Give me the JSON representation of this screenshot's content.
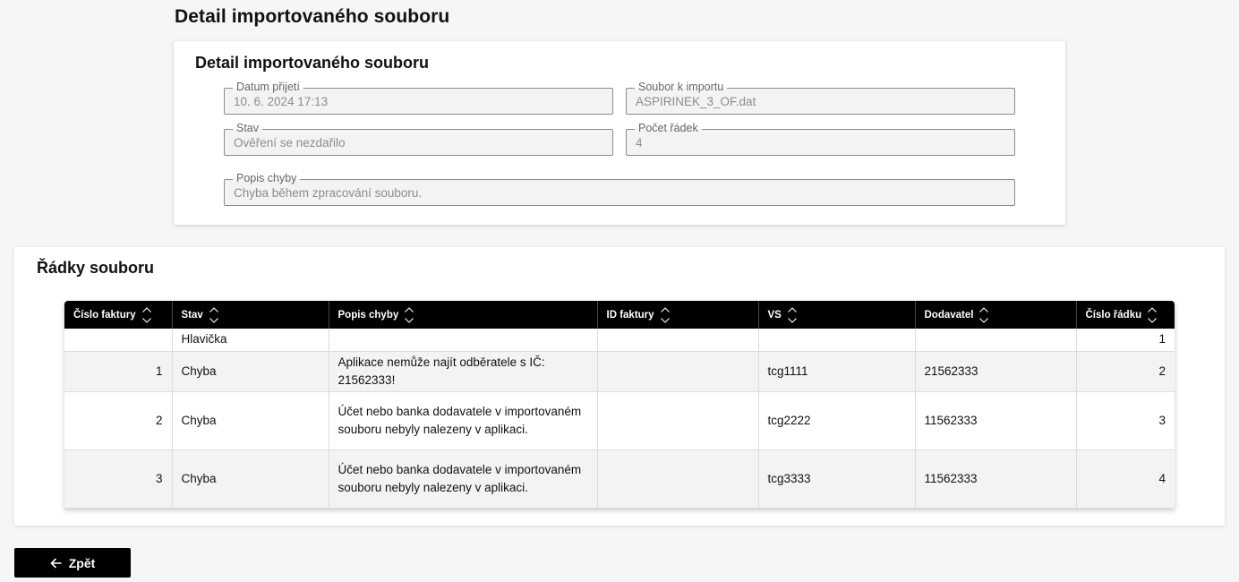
{
  "page": {
    "title": "Detail importovaného souboru"
  },
  "detail": {
    "title": "Detail importovaného souboru",
    "fields": {
      "datum_prijeti": {
        "label": "Datum přijetí",
        "value": "10. 6. 2024 17:13"
      },
      "soubor": {
        "label": "Soubor k importu",
        "value": "ASPIRINEK_3_OF.dat"
      },
      "stav": {
        "label": "Stav",
        "value": "Ověření se nezdařilo"
      },
      "pocet_radek": {
        "label": "Počet řádek",
        "value": "4"
      },
      "popis_chyby": {
        "label": "Popis chyby",
        "value": "Chyba během zpracování souboru."
      }
    }
  },
  "rows": {
    "title": "Řádky souboru",
    "columns": [
      "Číslo faktury",
      "Stav",
      "Popis chyby",
      "ID faktury",
      "VS",
      "Dodavatel",
      "Číslo řádku"
    ],
    "items": [
      {
        "cislo_faktury": "",
        "stav": "Hlavička",
        "popis_chyby": "",
        "id_faktury": "",
        "vs": "",
        "dodavatel": "",
        "cislo_radku": "1"
      },
      {
        "cislo_faktury": "1",
        "stav": "Chyba",
        "popis_chyby": "Aplikace nemůže najít odběratele s IČ: 21562333!",
        "id_faktury": "",
        "vs": "tcg1111",
        "dodavatel": "21562333",
        "cislo_radku": "2"
      },
      {
        "cislo_faktury": "2",
        "stav": "Chyba",
        "popis_chyby": "Účet nebo banka dodavatele v importovaném souboru nebyly nalezeny v aplikaci.",
        "id_faktury": "",
        "vs": "tcg2222",
        "dodavatel": "11562333",
        "cislo_radku": "3"
      },
      {
        "cislo_faktury": "3",
        "stav": "Chyba",
        "popis_chyby": "Účet nebo banka dodavatele v importovaném souboru nebyly nalezeny v aplikaci.",
        "id_faktury": "",
        "vs": "tcg3333",
        "dodavatel": "11562333",
        "cislo_radku": "4"
      }
    ]
  },
  "back_button": {
    "label": "Zpět",
    "icon": "arrow-left-icon"
  },
  "icons": {
    "sort": "sort-icon"
  }
}
